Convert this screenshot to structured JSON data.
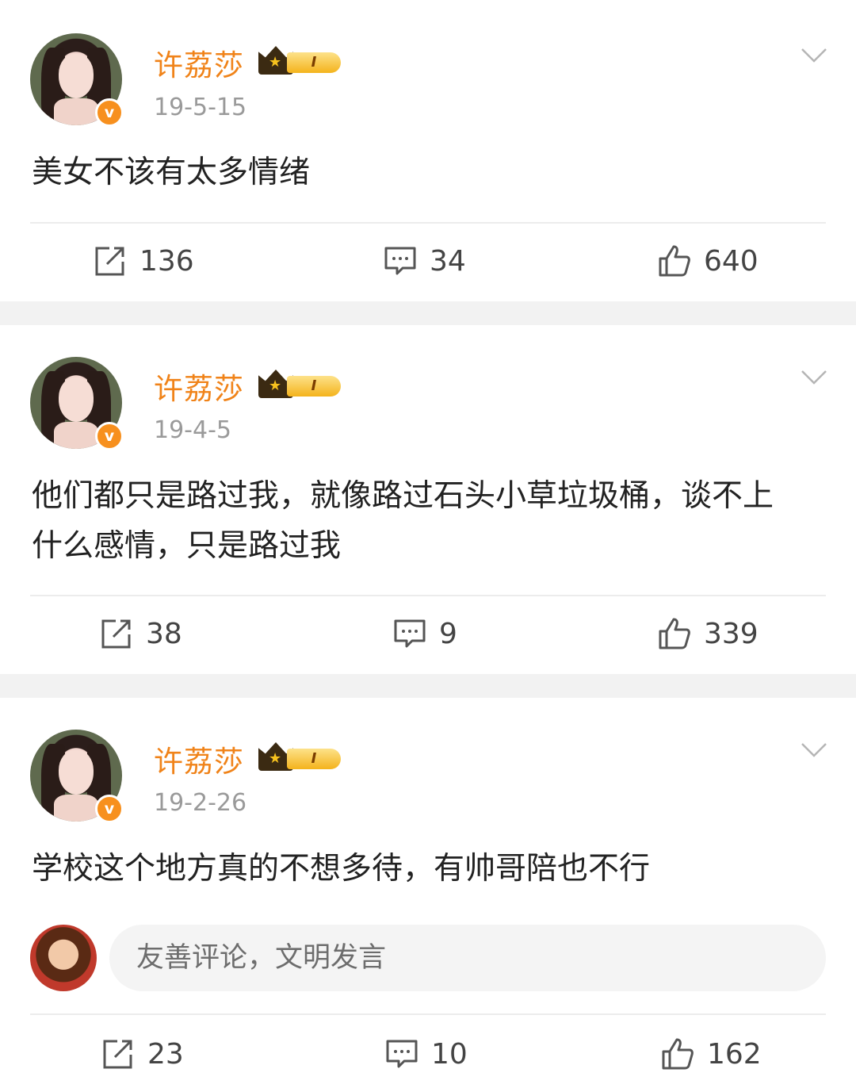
{
  "posts": [
    {
      "username": "许荔莎",
      "vip_level": "I",
      "date": "19-5-15",
      "content": "美女不该有太多情绪",
      "reposts": "136",
      "comments": "34",
      "likes": "640"
    },
    {
      "username": "许荔莎",
      "vip_level": "I",
      "date": "19-4-5",
      "content": "他们都只是路过我，就像路过石头小草垃圾桶，谈不上什么感情，只是路过我",
      "reposts": "38",
      "comments": "9",
      "likes": "339"
    },
    {
      "username": "许荔莎",
      "vip_level": "I",
      "date": "19-2-26",
      "content": "学校这个地方真的不想多待，有帅哥陪也不行",
      "reposts": "23",
      "comments": "10",
      "likes": "162"
    }
  ],
  "comment_box": {
    "placeholder": "友善评论，文明发言"
  },
  "verified_mark": "v",
  "icons": {
    "repost": "repost-icon",
    "comment": "comment-icon",
    "like": "thumbs-up-icon",
    "menu": "chevron-down-icon"
  },
  "colors": {
    "username": "#f08319",
    "verified": "#f7901e",
    "separator": "#f2f2f2"
  }
}
